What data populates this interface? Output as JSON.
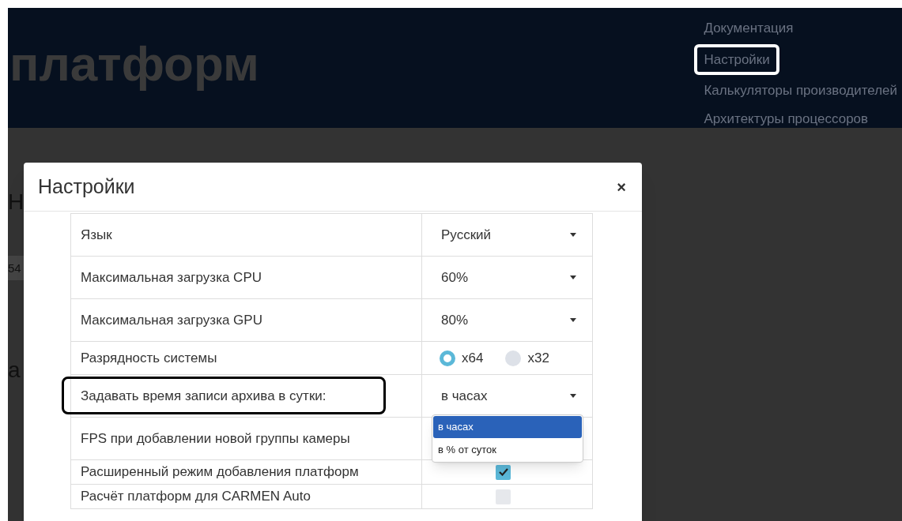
{
  "header": {
    "title": "платформ",
    "nav": [
      {
        "label": "Документация",
        "highlighted": false
      },
      {
        "label": "Настройки",
        "highlighted": true
      },
      {
        "label": "Калькуляторы производителей",
        "highlighted": false
      },
      {
        "label": "Архитектуры процессоров",
        "highlighted": false
      }
    ]
  },
  "background_fragments": [
    "Н",
    "54",
    "а"
  ],
  "dialog": {
    "title": "Настройки",
    "close": "×",
    "rows": [
      {
        "kind": "select",
        "label": "Язык",
        "value": "Русский",
        "highlighted": false
      },
      {
        "kind": "select",
        "label": "Максимальная загрузка CPU",
        "value": "60%",
        "highlighted": false
      },
      {
        "kind": "select",
        "label": "Максимальная загрузка GPU",
        "value": "80%",
        "highlighted": false
      },
      {
        "kind": "radio",
        "label": "Разрядность системы",
        "options": [
          {
            "label": "x64",
            "selected": true
          },
          {
            "label": "x32",
            "selected": false
          }
        ],
        "highlighted": false
      },
      {
        "kind": "select",
        "label": "Задавать время записи архива в сутки:",
        "value": "в часах",
        "highlighted": true,
        "expanded": true,
        "options": [
          {
            "label": "в часах",
            "selected": true
          },
          {
            "label": "в % от суток",
            "selected": false
          }
        ]
      },
      {
        "kind": "empty",
        "label": "FPS при добавлении новой группы камеры",
        "highlighted": false
      },
      {
        "kind": "checkbox",
        "label": "Расширенный режим добавления платформ",
        "checked": true,
        "highlighted": false
      },
      {
        "kind": "checkbox",
        "label": "Расчёт платформ для CARMEN Auto",
        "checked": false,
        "highlighted": false
      }
    ]
  }
}
